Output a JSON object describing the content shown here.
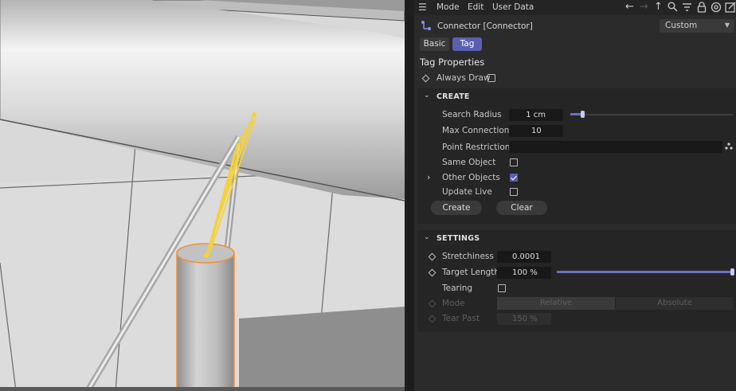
{
  "menubar": {
    "items": [
      "Mode",
      "Edit",
      "User Data"
    ],
    "icons": [
      "hamburger-menu-icon",
      "back-arrow-icon",
      "forward-arrow-icon",
      "up-arrow-icon",
      "search-icon",
      "filter-icon",
      "lock-icon",
      "target-icon",
      "new-window-icon"
    ]
  },
  "object": {
    "name": "Connector [Connector]",
    "icon": "connector-icon",
    "preset": "Custom"
  },
  "tabs": [
    "Basic",
    "Tag"
  ],
  "active_tab": "Tag",
  "tag_properties": {
    "title": "Tag Properties",
    "always_draw": {
      "label": "Always Draw",
      "checked": false
    }
  },
  "create": {
    "title": "CREATE",
    "search_radius": {
      "label": "Search Radius",
      "value": "1 cm",
      "slider_fraction": 0.01
    },
    "max_connections": {
      "label": "Max Connections",
      "value": "10"
    },
    "point_restriction": {
      "label": "Point Restriction",
      "value": ""
    },
    "same_object": {
      "label": "Same Object",
      "checked": false
    },
    "other_objects": {
      "label": "Other Objects",
      "checked": true
    },
    "update_live": {
      "label": "Update Live",
      "checked": false
    },
    "create_button": "Create",
    "clear_button": "Clear"
  },
  "settings": {
    "title": "SETTINGS",
    "stretchiness": {
      "label": "Stretchiness",
      "value": "0.0001"
    },
    "target_length": {
      "label": "Target Length",
      "value": "100 %",
      "slider_fraction": 1.0
    },
    "tearing": {
      "label": "Tearing",
      "checked": false
    },
    "mode": {
      "label": "Mode",
      "options": [
        "Relative",
        "Absolute"
      ],
      "selected": "Relative"
    },
    "tear_past": {
      "label": "Tear Past",
      "value": "150 %"
    }
  },
  "colors": {
    "accent": "#5b5fb0",
    "connector_yellow": "#f5d23a",
    "highlight_orange": "#f0903c"
  }
}
